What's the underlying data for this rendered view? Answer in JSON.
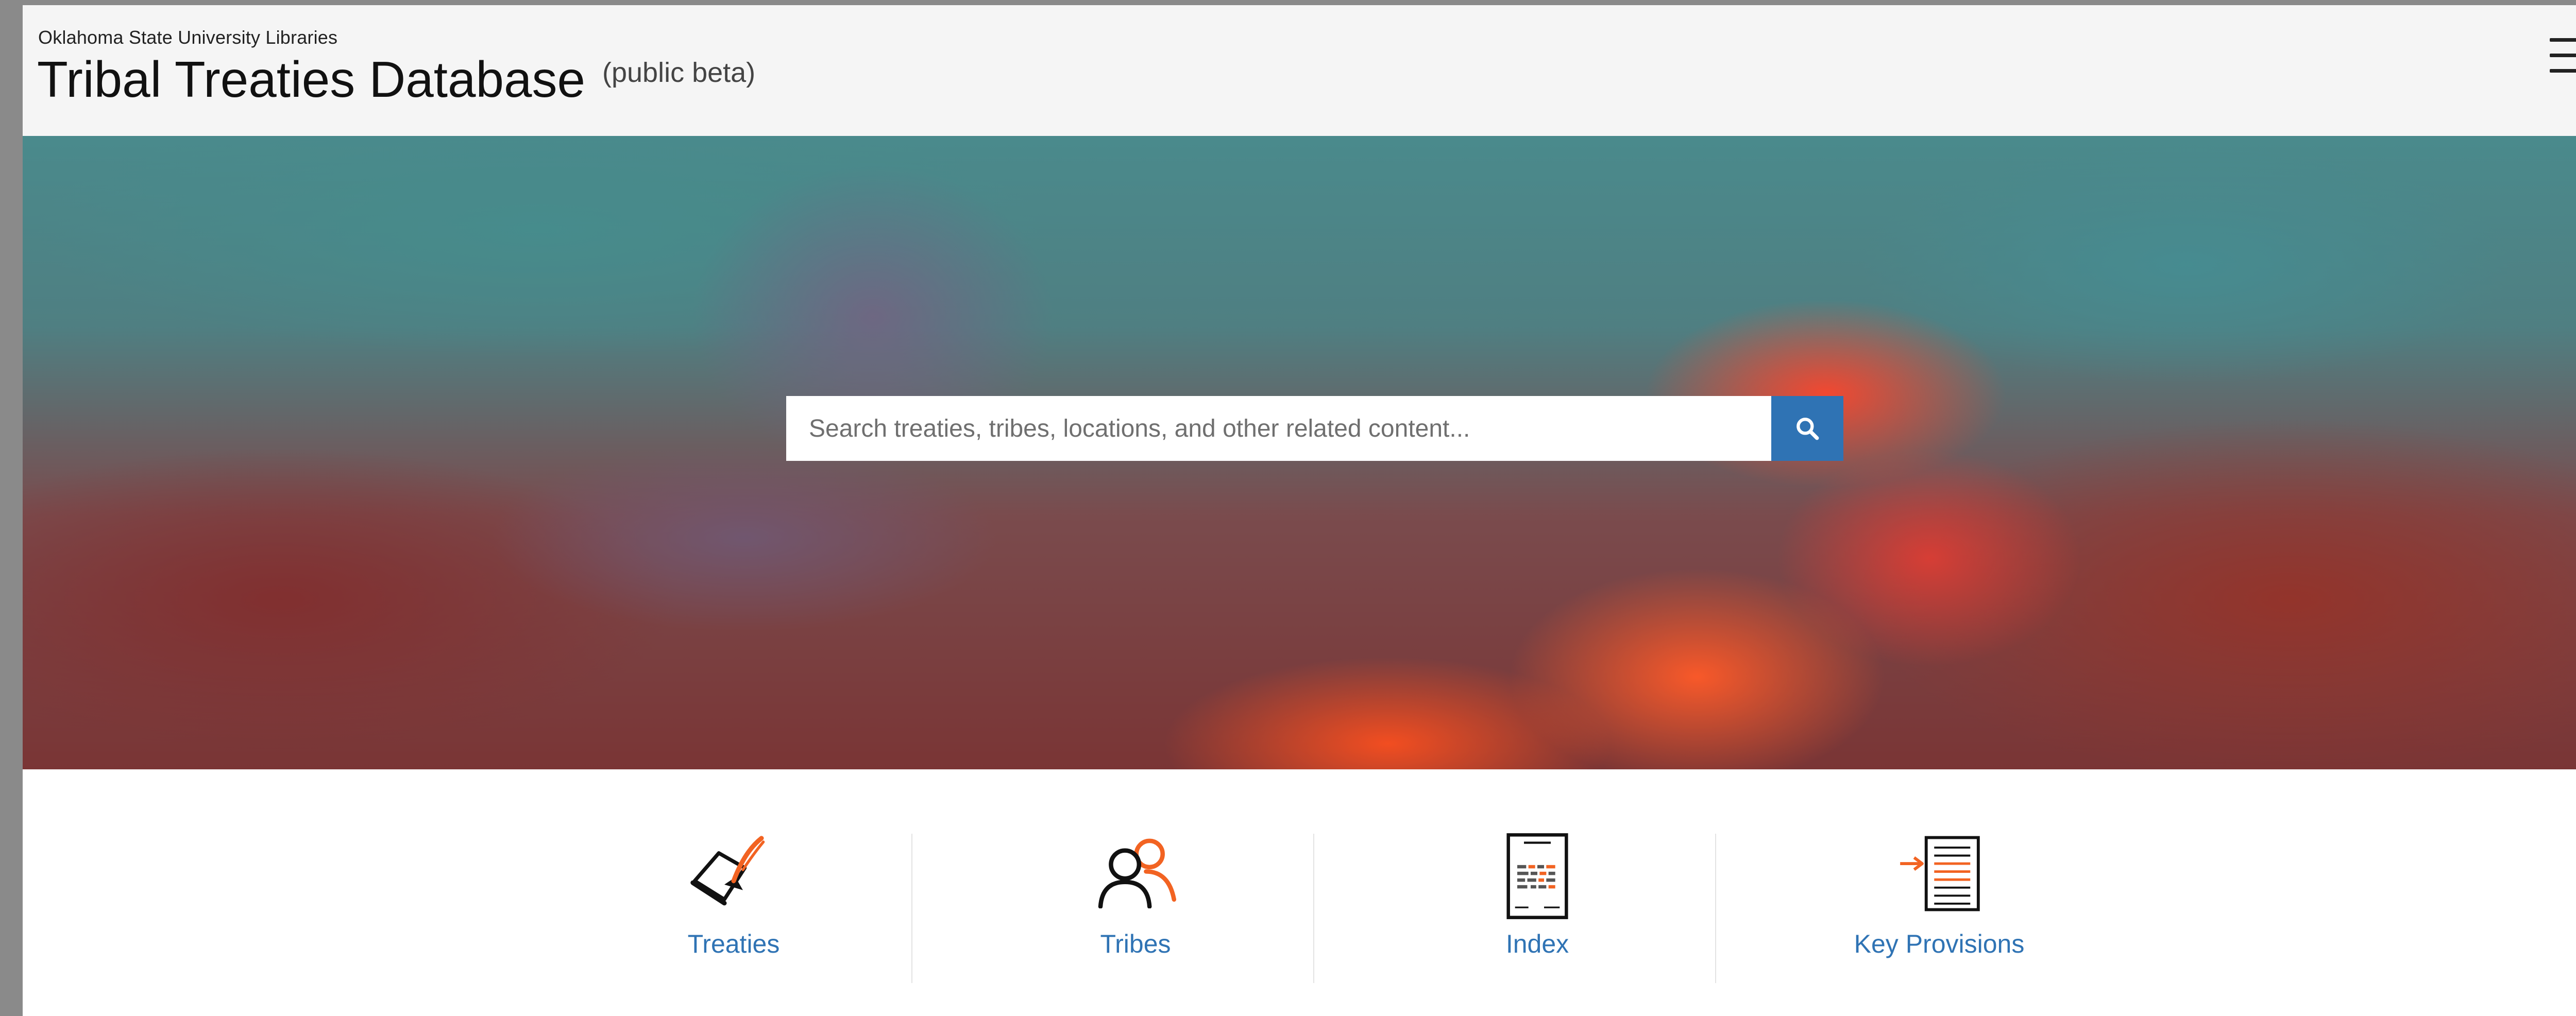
{
  "header": {
    "org": "Oklahoma State University Libraries",
    "title": "Tribal Treaties Database",
    "badge": "(public beta)",
    "menu_icon": "hamburger-menu-icon"
  },
  "search": {
    "placeholder": "Search treaties, tribes, locations, and other related content...",
    "button_icon": "search-icon"
  },
  "nav": {
    "items": [
      {
        "label": "Treaties",
        "icon": "treaty-document-quill-icon"
      },
      {
        "label": "Tribes",
        "icon": "people-icon"
      },
      {
        "label": "Index",
        "icon": "index-document-icon"
      },
      {
        "label": "Key Provisions",
        "icon": "key-provisions-document-arrow-icon"
      }
    ]
  },
  "colors": {
    "accent": "#F26322",
    "link": "#2F73B4",
    "header_bg": "#F5F5F5"
  }
}
